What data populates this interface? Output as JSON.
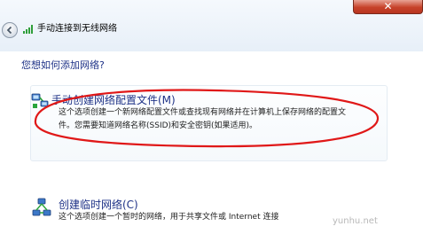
{
  "window": {
    "title": "手动连接到无线网络",
    "close_symbol": "✕"
  },
  "main": {
    "heading": "您想如何添加网络?",
    "options": [
      {
        "title": "手动创建网络配置文件(M)",
        "description_line1": "这个选项创建一个新网络配置文件或查找现有网络并在计算机上保存网络的配置文",
        "description_line2": "件。您需要知道网络名称(SSID)和安全密钥(如果适用)。"
      },
      {
        "title": "创建临时网络(C)",
        "description_line1": "这个选项创建一个暂时的网络，用于共享文件或 Internet 连接"
      }
    ]
  },
  "annotation": {
    "color": "#e01818"
  },
  "watermark": "yunhu.net"
}
